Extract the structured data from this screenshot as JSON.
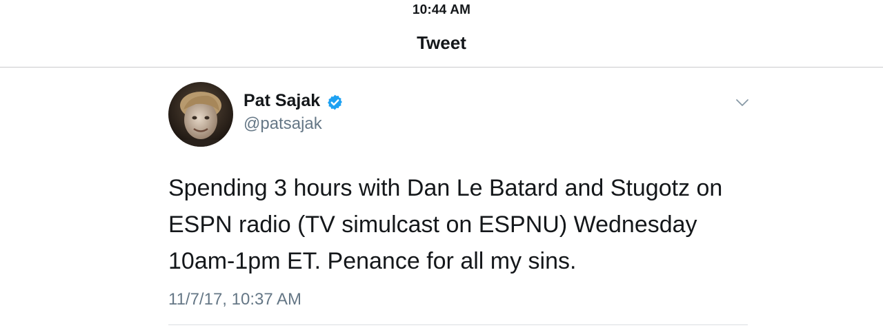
{
  "status_bar": {
    "time": "10:44 AM"
  },
  "nav": {
    "title": "Tweet"
  },
  "tweet": {
    "author": {
      "display_name": "Pat Sajak",
      "handle": "@patsajak",
      "verified": true,
      "avatar_icon": "profile-photo"
    },
    "text": "Spending 3 hours with Dan Le Batard and Stugotz on\nESPN radio (TV simulcast on  ESPNU) Wednesday\n10am-1pm ET.  Penance for all my sins.",
    "timestamp": "11/7/17, 10:37 AM",
    "menu_icon": "chevron-down-icon"
  },
  "colors": {
    "verified_blue": "#1da1f2",
    "secondary_text": "#657786",
    "primary_text": "#14171a"
  }
}
